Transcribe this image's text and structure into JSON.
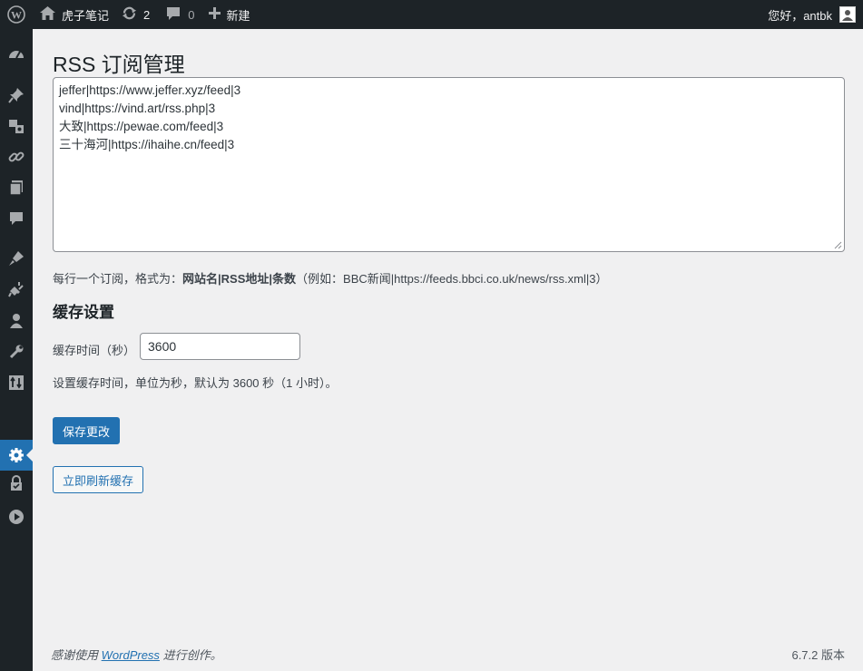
{
  "admin_bar": {
    "site_name": "虎子笔记",
    "updates_count": "2",
    "comments_count": "0",
    "new_label": "新建",
    "greeting": "您好，antbk"
  },
  "sidebar": {
    "icons": [
      "dashboard-icon",
      "pin-icon",
      "media-icon",
      "link-icon",
      "pages-icon",
      "comments-icon",
      "appearance-icon",
      "plugins-icon",
      "users-icon",
      "tools-icon",
      "import-icon",
      "settings-icon",
      "lock-icon",
      "play-icon"
    ],
    "current": "settings-icon"
  },
  "page": {
    "title": "RSS 订阅管理",
    "feeds": [
      "jeffer|https://www.jeffer.xyz/feed|3",
      "vind|https://vind.art/rss.php|3",
      "大致|https://pewae.com/feed|3",
      "三十海河|https://ihaihe.cn/feed|3"
    ],
    "format_desc_prefix": "每行一个订阅，格式为：",
    "format_desc_bold": "网站名|RSS地址|条数",
    "format_desc_suffix": "（例如：BBC新闻|https://feeds.bbci.co.uk/news/rss.xml|3）",
    "cache_section_title": "缓存设置",
    "cache_label": "缓存时间（秒）",
    "cache_value": "3600",
    "cache_desc": "设置缓存时间，单位为秒，默认为 3600 秒（1 小时）。",
    "save_button": "保存更改",
    "refresh_button": "立即刷新缓存"
  },
  "footer": {
    "thanks_prefix": "感谢使用",
    "thanks_link": "WordPress",
    "thanks_suffix": "进行创作。",
    "version": "6.7.2 版本"
  },
  "colors": {
    "admin_bar_bg": "#1d2327",
    "accent": "#2271b1",
    "page_bg": "#f0f0f1"
  }
}
